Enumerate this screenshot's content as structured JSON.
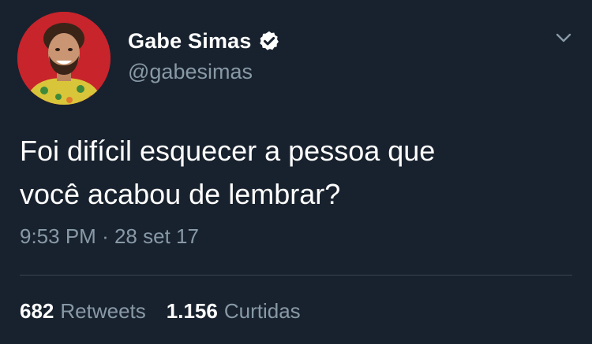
{
  "author": {
    "display_name": "Gabe Simas",
    "handle": "@gabesimas",
    "verified": true,
    "avatar_icon": "profile-photo"
  },
  "tweet": {
    "text_line1": "Foi difícil esquecer a pessoa que",
    "text_line2": "você acabou de lembrar?",
    "time": "9:53 PM",
    "separator": "·",
    "date": "28 set 17"
  },
  "stats": {
    "retweets_count": "682",
    "retweets_label": "Retweets",
    "likes_count": "1.156",
    "likes_label": "Curtidas"
  },
  "colors": {
    "background": "#18222e",
    "primary_text": "#ffffff",
    "secondary_text": "#8899a6",
    "divider": "#38444d",
    "avatar_bg": "#c8242c"
  },
  "icons": {
    "verified": "verified-badge-icon",
    "menu": "chevron-down-icon"
  }
}
